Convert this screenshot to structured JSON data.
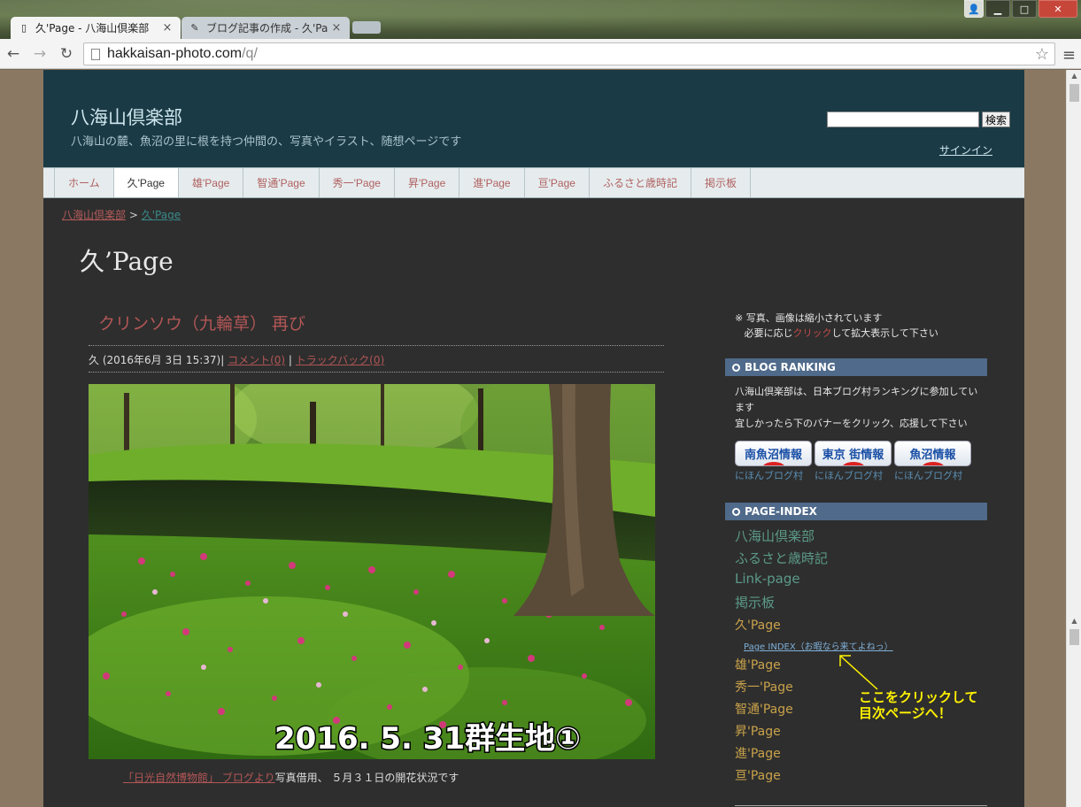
{
  "browser": {
    "tabs": [
      {
        "title": "久'Page - 八海山倶楽部",
        "active": true
      },
      {
        "title": "ブログ記事の作成 - 久'Pa",
        "active": false
      }
    ],
    "url_host": "hakkaisan-photo.com",
    "url_path": "/q/"
  },
  "site": {
    "title": "八海山倶楽部",
    "description": "八海山の麓、魚沼の里に根を持つ仲間の、写真やイラスト、随想ページです",
    "search_button": "検索",
    "signin": "サインイン",
    "nav": [
      "ホーム",
      "久'Page",
      "雄'Page",
      "智通'Page",
      "秀一'Page",
      "昇'Page",
      "進'Page",
      "亘'Page",
      "ふるさと歳時記",
      "掲示板"
    ],
    "nav_active_index": 1
  },
  "breadcrumb": {
    "home": "八海山倶楽部",
    "sep": ">",
    "current": "久'Page"
  },
  "page_heading": "久’Page",
  "post": {
    "title": "クリンソウ（九輪草） 再び",
    "author_date": "久 (2016年6月 3日 15:37)|",
    "comments": "コメント(0)",
    "sep": "|",
    "trackbacks": "トラックバック(0)",
    "photo_overlay": "2016. 5. 31群生地①",
    "caption_link": "「日光自然博物館」 ブログより",
    "caption_text": "写真借用、 ５月３１日の開花状況です"
  },
  "sidebar": {
    "notice_line1": "※ 写真、画像は縮小されています",
    "notice_line2_pre": "必要に応じ",
    "notice_line2_link": "クリック",
    "notice_line2_post": "して拡大表示して下さい",
    "ranking_header": "BLOG RANKING",
    "ranking_text1": "八海山倶楽部は、日本ブログ村ランキングに参加しています",
    "ranking_text2": "宜しかったら下のバナーをクリック、応援して下さい",
    "banners": [
      {
        "label": "南魚沼情報",
        "sub": "にほんブログ村"
      },
      {
        "label": "東京 街情報",
        "sub": "にほんブログ村"
      },
      {
        "label": "魚沼情報",
        "sub": "にほんブログ村"
      }
    ],
    "index_header": "PAGE-INDEX",
    "index_top": [
      "八海山倶楽部",
      "ふるさと歳時記",
      "Link-page",
      "掲示板"
    ],
    "index_current": "久'Page",
    "index_sub": "Page INDEX（お暇なら来てよねっ）",
    "index_rest": [
      "雄'Page",
      "秀一'Page",
      "智通'Page",
      "昇'Page",
      "進'Page",
      "亘'Page"
    ],
    "note_line1": "ここをクリックして",
    "note_line2": "目次ページへ！"
  },
  "colors": {
    "header": "#1a3a45",
    "link_red": "#b25656",
    "teal": "#5b9a87",
    "gold": "#c9a24a",
    "note_yellow": "#fff200"
  }
}
